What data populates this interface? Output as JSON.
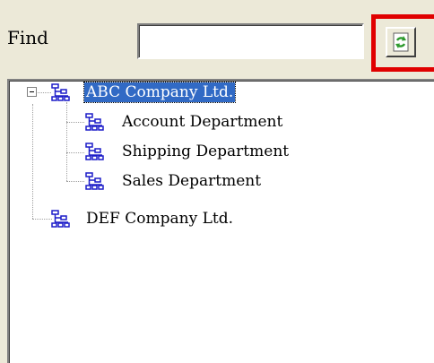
{
  "find": {
    "label": "Find",
    "value": "",
    "placeholder": ""
  },
  "refresh_button": {
    "icon": "refresh-icon"
  },
  "tree": {
    "nodes": [
      {
        "label": "ABC Company Ltd.",
        "selected": true,
        "expanded": true,
        "icon": "org-chart-icon"
      },
      {
        "label": "Account Department",
        "icon": "org-chart-icon"
      },
      {
        "label": "Shipping Department",
        "icon": "org-chart-icon"
      },
      {
        "label": "Sales Department",
        "icon": "org-chart-icon"
      },
      {
        "label": "DEF Company Ltd.",
        "icon": "org-chart-icon"
      }
    ]
  },
  "colors": {
    "highlight": "#e00000",
    "selection": "#316ac5",
    "icon_blue": "#1c1cc8",
    "refresh_green": "#2e9a2e"
  }
}
